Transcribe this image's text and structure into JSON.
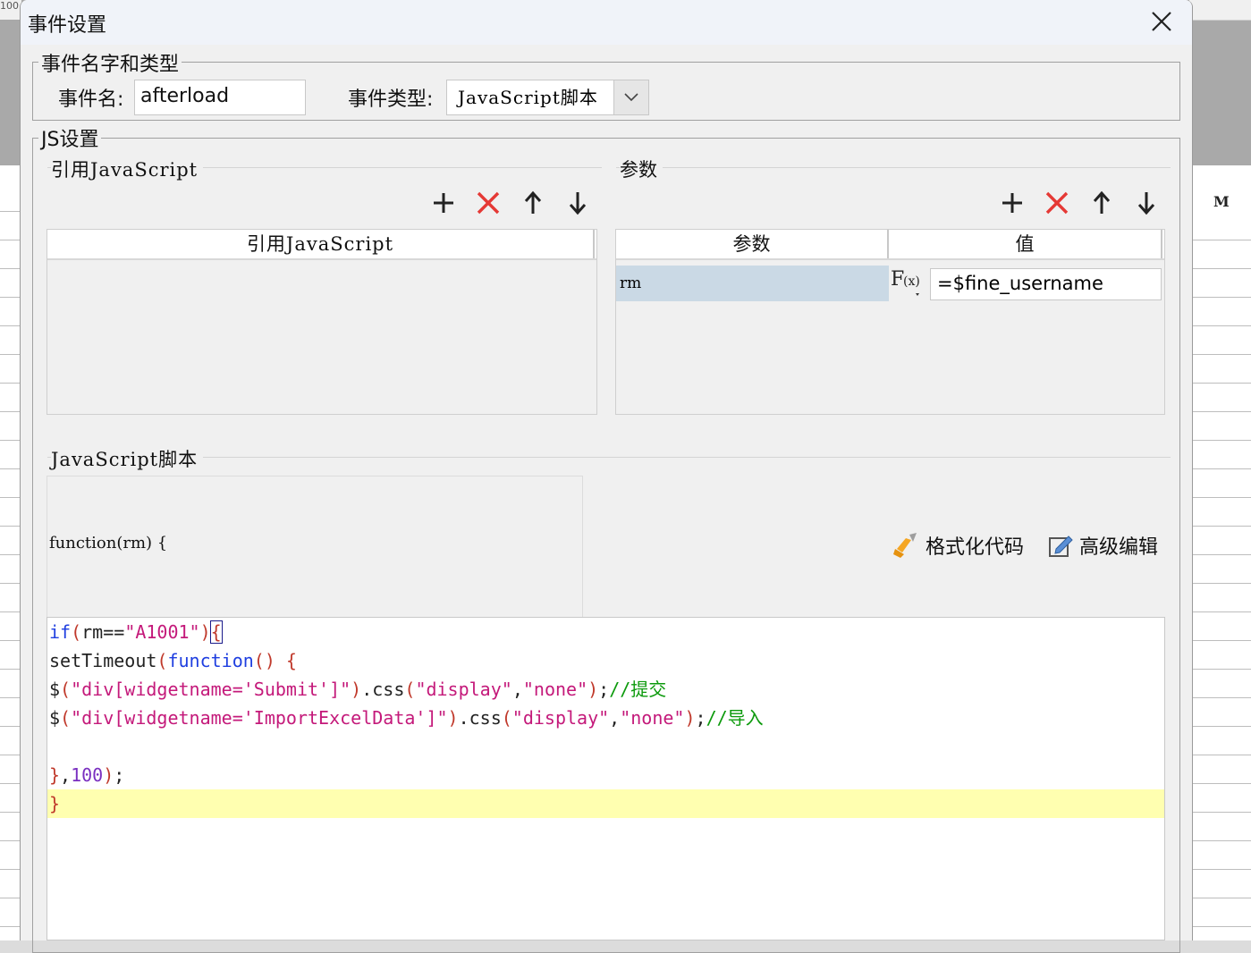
{
  "background": {
    "ruler_corner_text": "100",
    "column_header": "M"
  },
  "dialog": {
    "title": "事件设置",
    "close_icon": "close-icon"
  },
  "event_group": {
    "legend": "事件名字和类型",
    "name_label": "事件名:",
    "name_value": "afterload",
    "type_label": "事件类型:",
    "type_value": "JavaScript脚本"
  },
  "js_group": {
    "legend": "JS设置",
    "ref_section": {
      "title": "引用JavaScript",
      "column_header": "引用JavaScript",
      "toolbar": [
        "add-icon",
        "delete-icon",
        "move-up-icon",
        "move-down-icon"
      ]
    },
    "param_section": {
      "title": "参数",
      "columns": [
        "参数",
        "值"
      ],
      "rows": [
        {
          "name": "rm",
          "value": "=$fine_username"
        }
      ],
      "fx_label": "F(x)"
    },
    "script_section": {
      "title": "JavaScript脚本",
      "function_signature": "function(rm) {",
      "format_code_label": "格式化代码",
      "advanced_edit_label": "高级编辑",
      "code_lines": [
        [
          [
            "kw",
            "if"
          ],
          [
            "par",
            "("
          ],
          [
            "plain",
            "rm=="
          ],
          [
            "str",
            "\"A1001\""
          ],
          [
            "par",
            ")"
          ],
          [
            "par",
            "{"
          ]
        ],
        [
          [
            "plain",
            "setTimeout"
          ],
          [
            "par",
            "("
          ],
          [
            "kw",
            "function"
          ],
          [
            "par",
            "() {"
          ]
        ],
        [
          [
            "plain",
            "$"
          ],
          [
            "par",
            "("
          ],
          [
            "str",
            "\"div[widgetname='Submit']\""
          ],
          [
            "par",
            ")"
          ],
          [
            "plain",
            ".css"
          ],
          [
            "par",
            "("
          ],
          [
            "str",
            "\"display\""
          ],
          [
            "plain",
            ","
          ],
          [
            "str",
            "\"none\""
          ],
          [
            "par",
            ")"
          ],
          [
            "plain",
            ";"
          ],
          [
            "cmt",
            "//提交"
          ]
        ],
        [
          [
            "plain",
            "$"
          ],
          [
            "par",
            "("
          ],
          [
            "str",
            "\"div[widgetname='ImportExcelData']\""
          ],
          [
            "par",
            ")"
          ],
          [
            "plain",
            ".css"
          ],
          [
            "par",
            "("
          ],
          [
            "str",
            "\"display\""
          ],
          [
            "plain",
            ","
          ],
          [
            "str",
            "\"none\""
          ],
          [
            "par",
            ")"
          ],
          [
            "plain",
            ";"
          ],
          [
            "cmt",
            "//导入"
          ]
        ],
        [],
        [
          [
            "par",
            "}"
          ],
          [
            "plain",
            ","
          ],
          [
            "num",
            "100"
          ],
          [
            "par",
            ")"
          ],
          [
            "plain",
            ";"
          ]
        ],
        [
          [
            "par",
            "}"
          ]
        ]
      ],
      "highlighted_line": 7
    }
  }
}
